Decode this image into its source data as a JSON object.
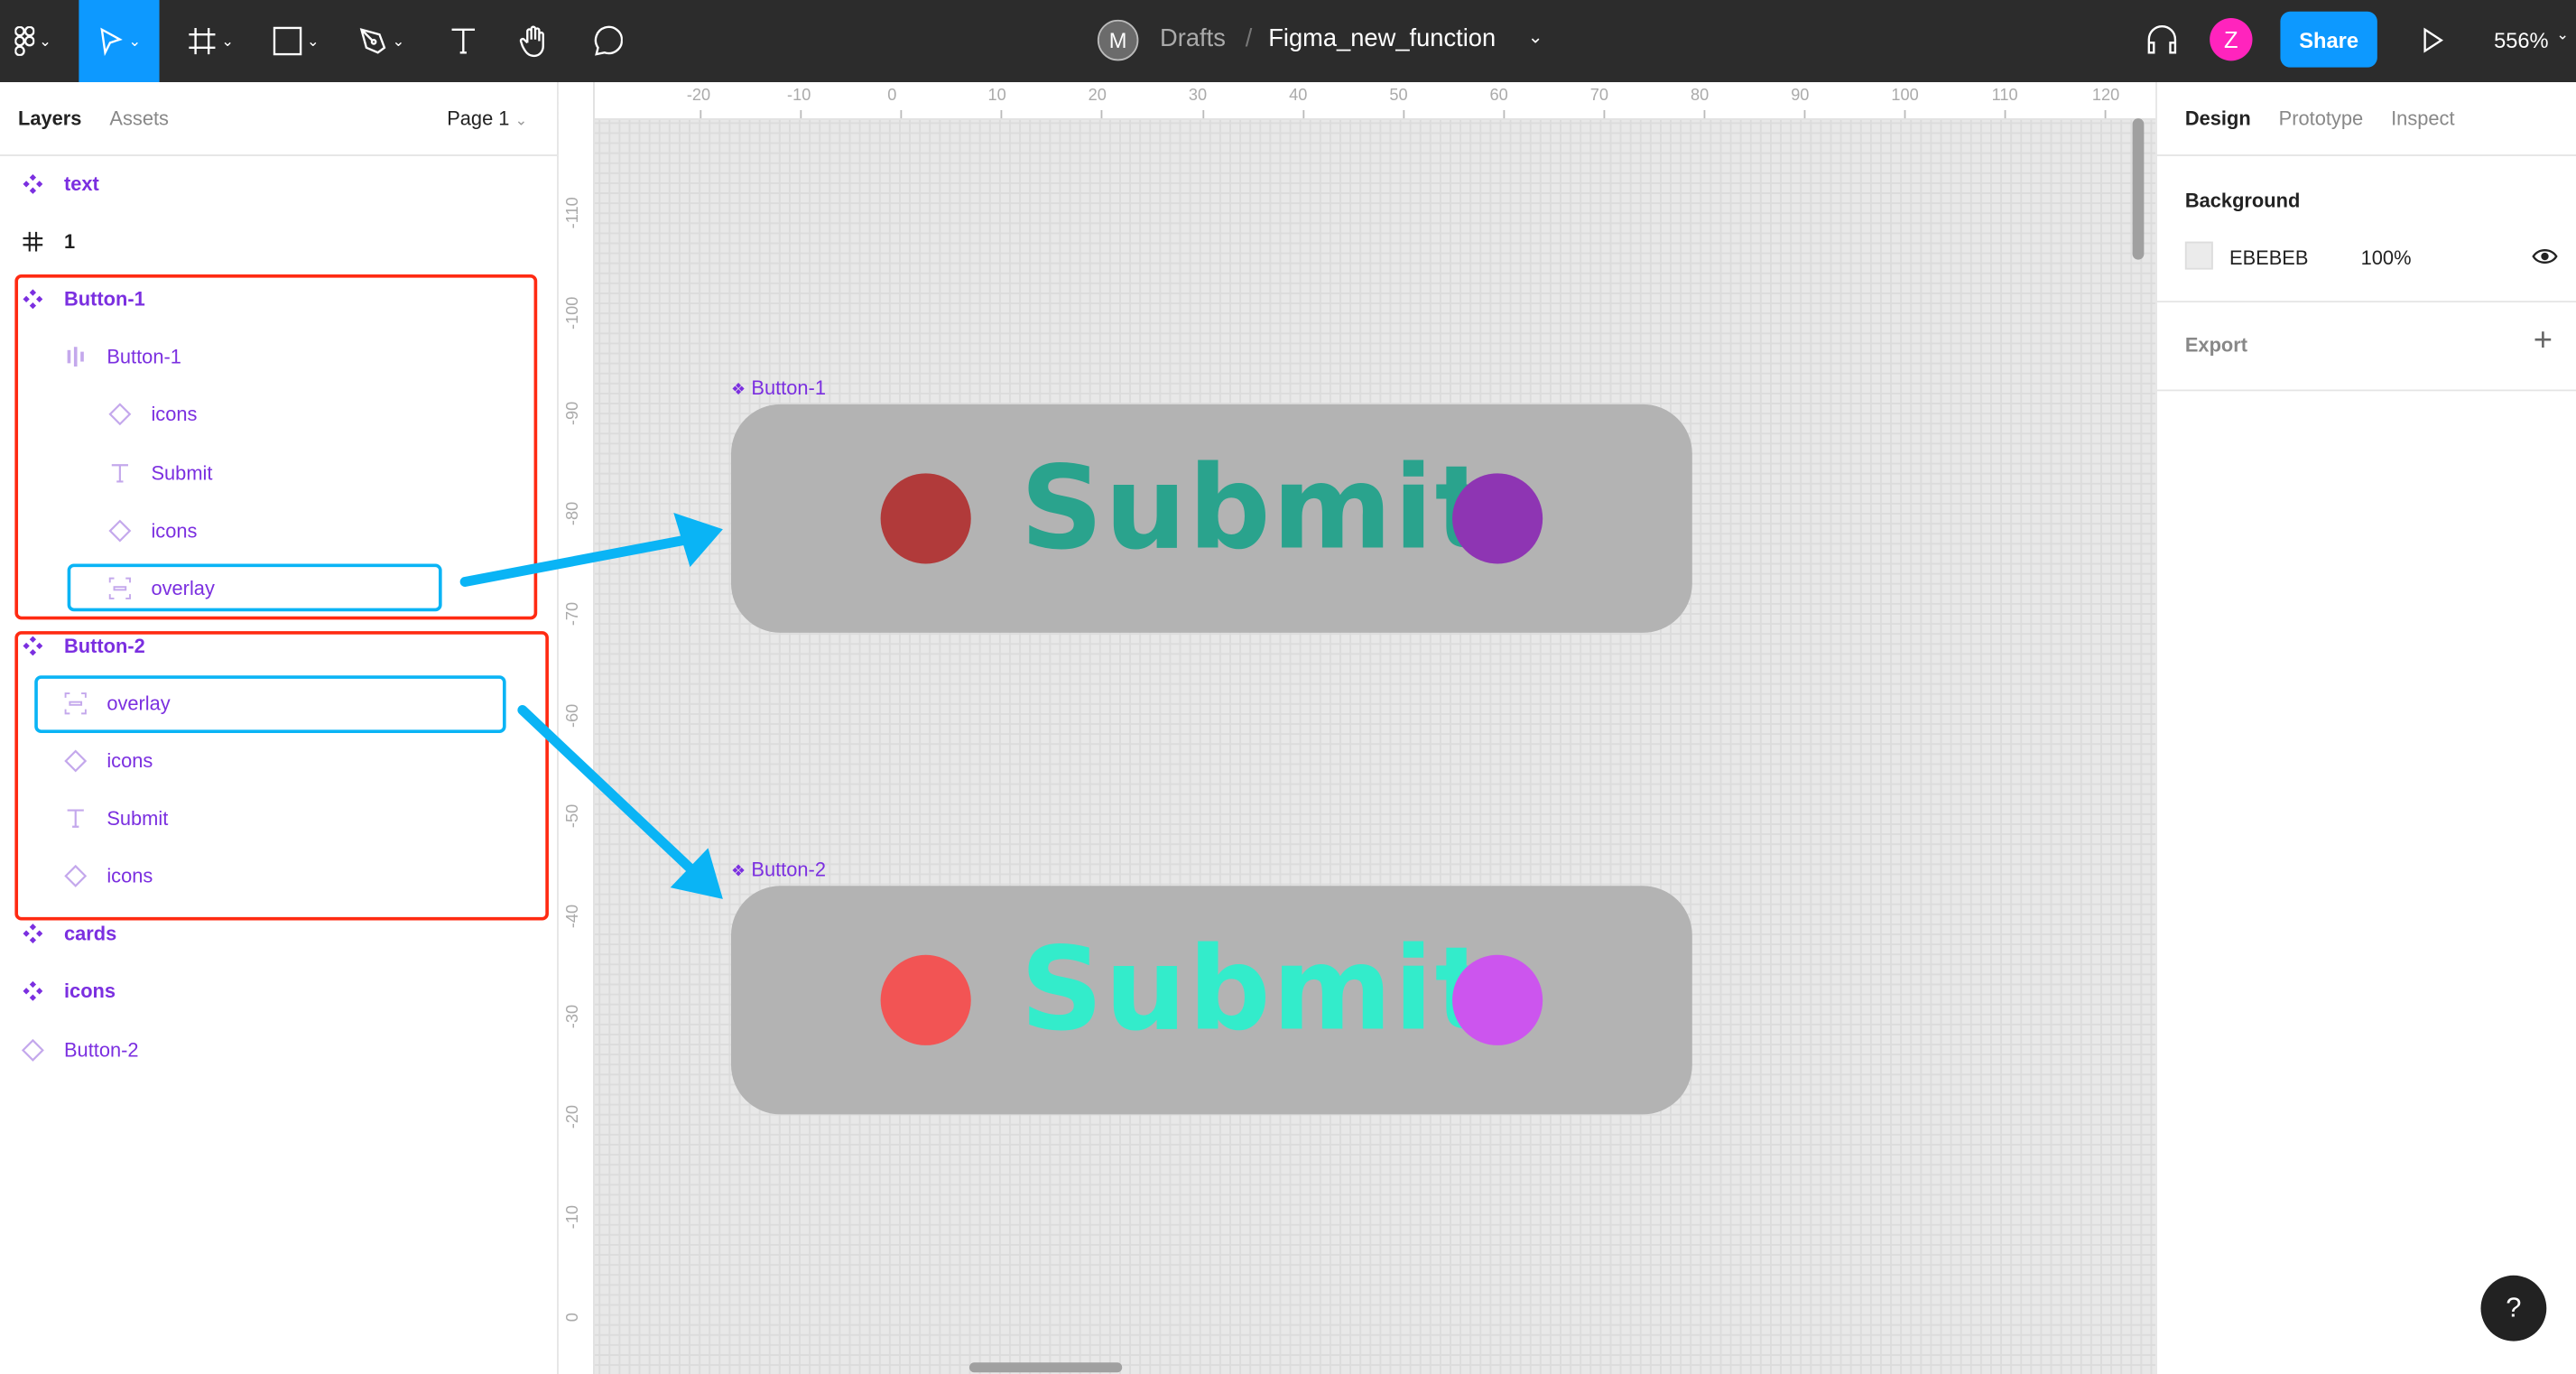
{
  "toolbar": {
    "file_avatar": "M",
    "breadcrumb_root": "Drafts",
    "breadcrumb_sep": "/",
    "file_name": "Figma_new_function",
    "user_avatar": "Z",
    "share_label": "Share",
    "zoom": "556%",
    "accent": "#0d99ff",
    "user_color": "#ff24bd"
  },
  "left_panel": {
    "tabs": [
      "Layers",
      "Assets"
    ],
    "page": "Page 1",
    "layers": [
      {
        "label": "text",
        "icon": "component-icon",
        "bold": true
      },
      {
        "label": "1",
        "icon": "frame-icon",
        "bold": true
      },
      {
        "label": "Button-1",
        "icon": "component-icon",
        "bold": true
      },
      {
        "label": "Button-1",
        "icon": "auto-layout-icon"
      },
      {
        "label": "icons",
        "icon": "instance-icon"
      },
      {
        "label": "Submit",
        "icon": "text-icon"
      },
      {
        "label": "icons",
        "icon": "instance-icon"
      },
      {
        "label": "overlay",
        "icon": "overlay-icon"
      },
      {
        "label": "Button-2",
        "icon": "component-icon",
        "bold": true
      },
      {
        "label": "overlay",
        "icon": "overlay-icon"
      },
      {
        "label": "icons",
        "icon": "instance-icon"
      },
      {
        "label": "Submit",
        "icon": "text-icon"
      },
      {
        "label": "icons",
        "icon": "instance-icon"
      },
      {
        "label": "cards",
        "icon": "component-icon",
        "bold": true
      },
      {
        "label": "icons",
        "icon": "component-icon",
        "bold": true
      },
      {
        "label": "Button-2",
        "icon": "instance-icon"
      }
    ]
  },
  "canvas": {
    "h_ruler": [
      "-20",
      "-10",
      "0",
      "10",
      "20",
      "30",
      "40",
      "50",
      "60",
      "70",
      "80",
      "90",
      "100",
      "110",
      "120"
    ],
    "v_ruler": [
      "-110",
      "-100",
      "-90",
      "-80",
      "-70",
      "-60",
      "-50",
      "-40",
      "-30",
      "-20",
      "-10",
      "0"
    ],
    "buttons": [
      {
        "frame_label": "Button-1",
        "text": "Submit",
        "text_color": "#2aa38d",
        "left_dot": "#b13a3a",
        "right_dot": "#8e35b3"
      },
      {
        "frame_label": "Button-2",
        "text": "Submit",
        "text_color": "#33eccb",
        "left_dot": "#f25454",
        "right_dot": "#cc55ee"
      }
    ]
  },
  "right_panel": {
    "tabs": [
      "Design",
      "Prototype",
      "Inspect"
    ],
    "background_title": "Background",
    "bg_hex": "EBEBEB",
    "bg_opacity": "100%",
    "export_label": "Export"
  },
  "help": "?",
  "annotation_colors": {
    "red": "#ff2a12",
    "blue": "#0ab4f5"
  }
}
